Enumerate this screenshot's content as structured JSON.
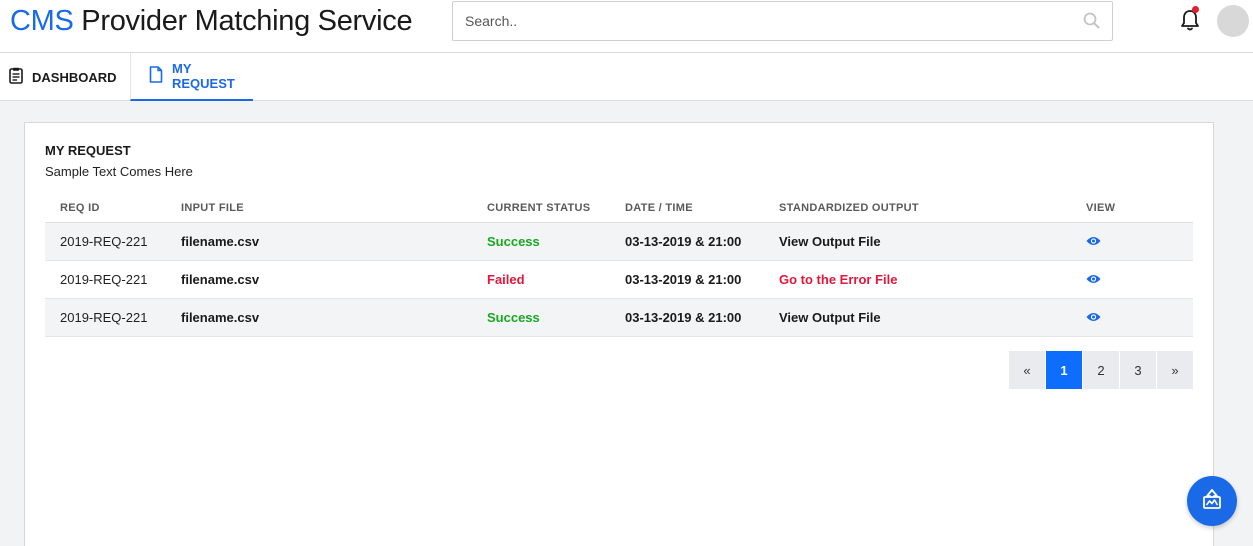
{
  "header": {
    "logo_brand": "CMS",
    "logo_rest": " Provider Matching Service",
    "search_placeholder": "Search..",
    "icons": {
      "search": "search-icon",
      "notifications": "bell-icon",
      "avatar": "avatar"
    },
    "colors": {
      "brand": "#1a6ae8",
      "notification_dot": "#e0202c"
    }
  },
  "tabs": [
    {
      "label": "DASHBOARD",
      "icon": "clipboard-icon",
      "active": false
    },
    {
      "label": "MY REQUEST",
      "icon": "document-icon",
      "active": true
    }
  ],
  "card": {
    "title": "MY REQUEST",
    "subtitle": "Sample Text Comes Here"
  },
  "table": {
    "columns": [
      "REQ ID",
      "INPUT FILE",
      "CURRENT STATUS",
      "DATE / TIME",
      "STANDARDIZED OUTPUT",
      "VIEW"
    ],
    "rows": [
      {
        "req_id": "2019-REQ-221",
        "input_file": "filename.csv",
        "status": "Success",
        "datetime": "03-13-2019 & 21:00",
        "output": "View Output File",
        "view_icon": "eye-icon"
      },
      {
        "req_id": "2019-REQ-221",
        "input_file": "filename.csv",
        "status": "Failed",
        "datetime": "03-13-2019 & 21:00",
        "output": "Go to the Error File",
        "view_icon": "eye-icon"
      },
      {
        "req_id": "2019-REQ-221",
        "input_file": "filename.csv",
        "status": "Success",
        "datetime": "03-13-2019 & 21:00",
        "output": "View Output File",
        "view_icon": "eye-icon"
      }
    ],
    "colors": {
      "success": "#17a81f",
      "failed": "#e0183c",
      "link": "#1a6ae8"
    }
  },
  "pagination": {
    "prev": "«",
    "pages": [
      "1",
      "2",
      "3"
    ],
    "current": "1",
    "next": "»",
    "active_color": "#0d6efd"
  },
  "fab": {
    "icon": "chart-upload-icon"
  }
}
